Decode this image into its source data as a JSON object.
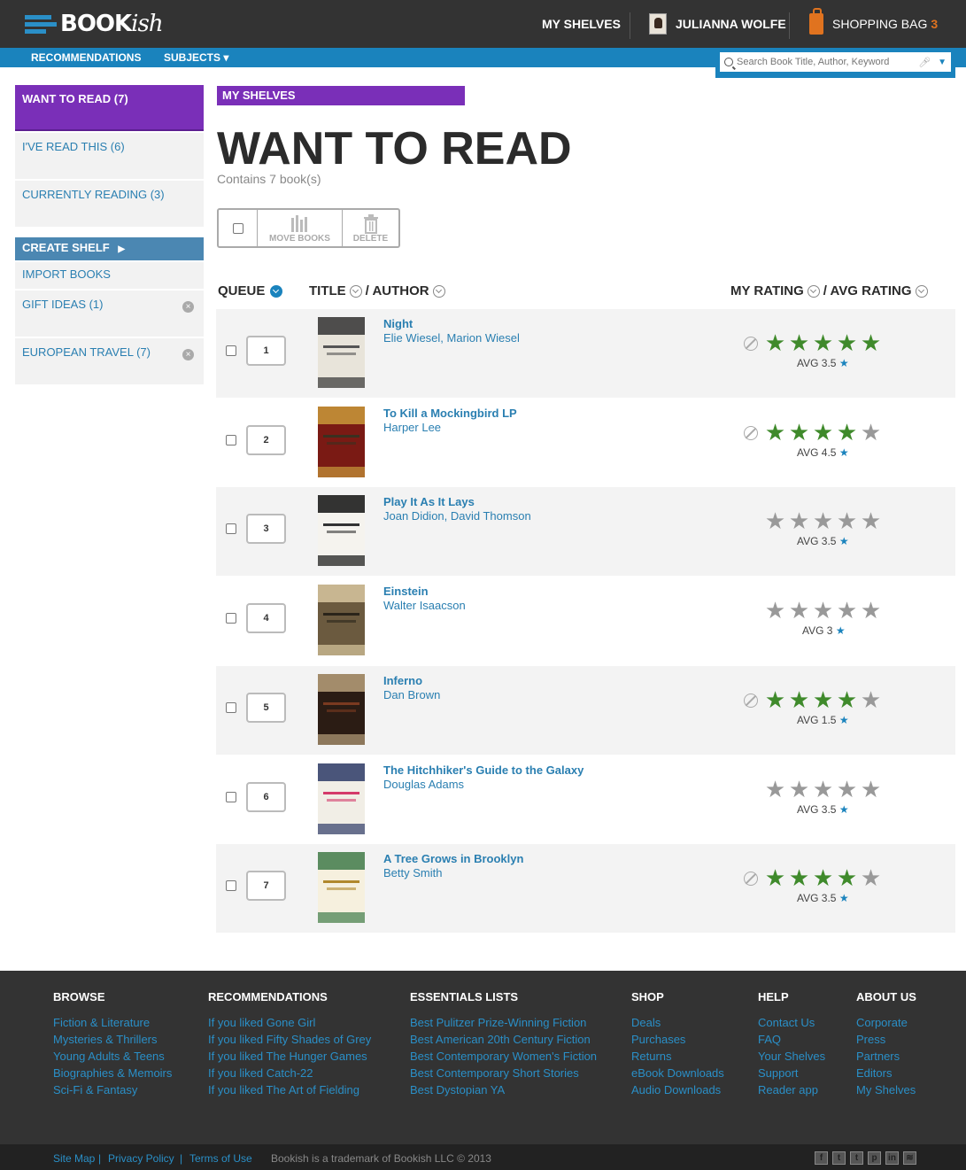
{
  "header": {
    "logo": "BOOKish",
    "logo_main": "BOOK",
    "logo_script": "ish",
    "nav_shelves": "MY SHELVES",
    "user_name": "JULIANNA WOLFE",
    "bag_label": "SHOPPING BAG",
    "bag_count": "3",
    "brand_color": "#1a83bd"
  },
  "navbar": {
    "recommendations": "RECOMMENDATIONS",
    "subjects": "SUBJECTS ▾",
    "search_placeholder": "Search Book Title, Author, Keyword"
  },
  "sidebar": {
    "shelves": [
      {
        "label": "WANT TO READ (7)",
        "active": true
      },
      {
        "label": "I'VE READ THIS (6)"
      },
      {
        "label": "CURRENTLY READING (3)"
      }
    ],
    "create_shelf": "CREATE SHELF",
    "import_books": "IMPORT BOOKS",
    "custom": [
      {
        "label": "GIFT IDEAS (1)"
      },
      {
        "label": "EUROPEAN TRAVEL (7)"
      }
    ]
  },
  "main": {
    "badge": "MY SHELVES",
    "title": "WANT TO READ",
    "count": "Contains 7 book(s)",
    "move_books": "MOVE BOOKS",
    "delete": "DELETE",
    "col_queue": "QUEUE",
    "col_title": "TITLE",
    "col_author": "/ AUTHOR",
    "col_my_rating": "MY RATING",
    "col_avg_rating": "/ AVG RATING",
    "accent_color": "#7a2fb8"
  },
  "books": [
    {
      "queue": "1",
      "title": "Night",
      "author": "Elie Wiesel, Marion Wiesel",
      "my_rating": 5,
      "rated": true,
      "avg": "AVG 3.5"
    },
    {
      "queue": "2",
      "title": "To Kill a Mockingbird LP",
      "author": "Harper Lee",
      "my_rating": 4,
      "rated": true,
      "avg": "AVG 4.5"
    },
    {
      "queue": "3",
      "title": "Play It As It Lays",
      "author": "Joan Didion, David Thomson",
      "my_rating": 0,
      "rated": false,
      "avg": "AVG 3.5"
    },
    {
      "queue": "4",
      "title": "Einstein",
      "author": "Walter Isaacson",
      "my_rating": 0,
      "rated": false,
      "avg": "AVG 3"
    },
    {
      "queue": "5",
      "title": "Inferno",
      "author": "Dan Brown",
      "my_rating": 4,
      "rated": true,
      "avg": "AVG 1.5"
    },
    {
      "queue": "6",
      "title": "The Hitchhiker's Guide to the Galaxy",
      "author": "Douglas Adams",
      "my_rating": 0,
      "rated": false,
      "avg": "AVG 3.5"
    },
    {
      "queue": "7",
      "title": "A Tree Grows in Brooklyn",
      "author": "Betty Smith",
      "my_rating": 4,
      "rated": true,
      "avg": "AVG 3.5"
    }
  ],
  "footer": {
    "browse": {
      "head": "BROWSE",
      "links": [
        "Fiction & Literature",
        "Mysteries & Thrillers",
        "Young Adults & Teens",
        "Biographies & Memoirs",
        "Sci-Fi & Fantasy"
      ]
    },
    "recommendations": {
      "head": "RECOMMENDATIONS",
      "links": [
        "If you liked Gone Girl",
        "If you liked Fifty Shades of Grey",
        "If you liked The Hunger Games",
        "If you liked Catch-22",
        "If you liked The Art of Fielding"
      ]
    },
    "essentials": {
      "head": "ESSENTIALS LISTS",
      "links": [
        "Best Pulitzer Prize-Winning Fiction",
        "Best American 20th Century Fiction",
        "Best Contemporary Women's Fiction",
        "Best Contemporary Short Stories",
        "Best Dystopian YA"
      ]
    },
    "shop": {
      "head": "SHOP",
      "links": [
        "Deals",
        "Purchases",
        "Returns",
        "eBook Downloads",
        "Audio Downloads"
      ]
    },
    "help": {
      "head": "HELP",
      "links": [
        "Contact Us",
        "FAQ",
        "Your Shelves",
        "Support",
        "Reader app"
      ]
    },
    "about": {
      "head": "ABOUT US",
      "links": [
        "Corporate",
        "Press",
        "Partners",
        "Editors",
        "My Shelves"
      ]
    },
    "site_map": "Site Map",
    "privacy": "Privacy Policy",
    "terms": "Terms of Use",
    "trademark": "Bookish is a trademark of Bookish LLC © 2013",
    "social_icons": [
      "facebook-icon",
      "twitter-icon",
      "tumblr-icon",
      "pinterest-icon",
      "linkedin-icon",
      "rss-icon"
    ]
  }
}
